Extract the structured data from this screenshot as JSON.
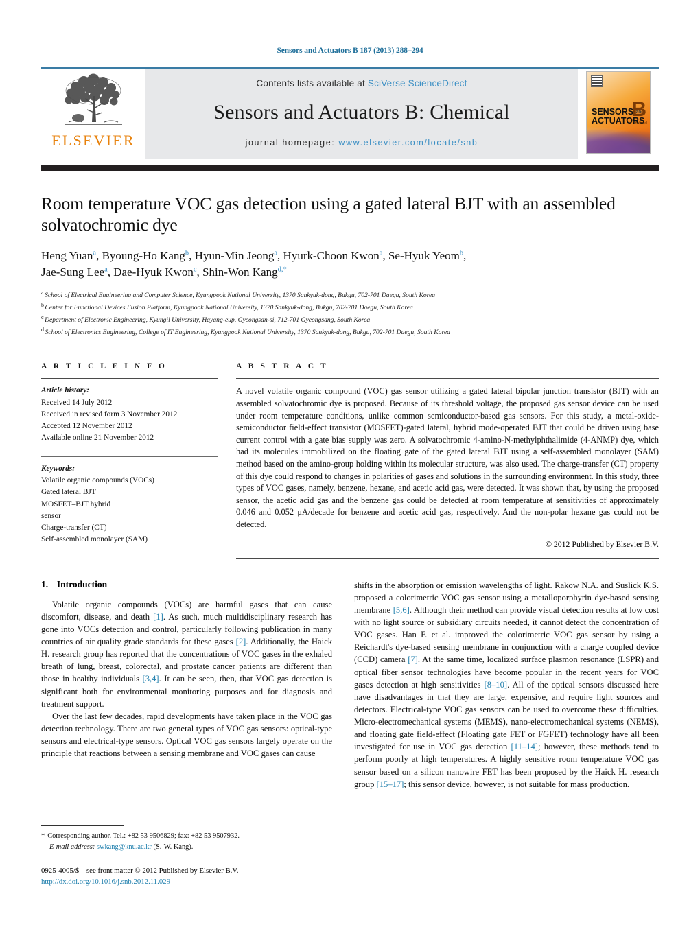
{
  "running_head": "Sensors and Actuators B 187 (2013) 288–294",
  "masthead": {
    "publisher_name": "ELSEVIER",
    "contents_prefix": "Contents lists available at ",
    "contents_link": "SciVerse ScienceDirect",
    "journal_title": "Sensors and Actuators B: Chemical",
    "homepage_prefix": "journal homepage: ",
    "homepage_url": "www.elsevier.com/locate/snb",
    "cover": {
      "line1": "SENSORS",
      "and": "and",
      "line2": "ACTUATORS",
      "letter": "B",
      "letter_sub": "Chemical"
    }
  },
  "article": {
    "title": "Room temperature VOC gas detection using a gated lateral BJT with an assembled solvatochromic dye",
    "authors": [
      {
        "name": "Heng Yuan",
        "marks": "a",
        "sep": ", "
      },
      {
        "name": "Byoung-Ho Kang",
        "marks": "b",
        "sep": ", "
      },
      {
        "name": "Hyun-Min Jeong",
        "marks": "a",
        "sep": ", "
      },
      {
        "name": "Hyurk-Choon Kwon",
        "marks": "a",
        "sep": ", "
      },
      {
        "name": "Se-Hyuk Yeom",
        "marks": "b",
        "sep": ","
      },
      {
        "name": "Jae-Sung Lee",
        "marks": "a",
        "sep": ", "
      },
      {
        "name": "Dae-Hyuk Kwon",
        "marks": "c",
        "sep": ", "
      },
      {
        "name": "Shin-Won Kang",
        "marks": "d,*",
        "sep": ""
      }
    ],
    "affiliations": [
      {
        "mark": "a",
        "text": "School of Electrical Engineering and Computer Science, Kyungpook National University, 1370 Sankyuk-dong, Bukgu, 702-701 Daegu, South Korea"
      },
      {
        "mark": "b",
        "text": "Center for Functional Devices Fusion Platform, Kyungpook National University, 1370 Sankyuk-dong, Bukgu, 702-701 Daegu, South Korea"
      },
      {
        "mark": "c",
        "text": "Department of Electronic Engineering, Kyungil University, Hayang-eup, Gyeongsan-si, 712-701 Gyeongsang, South Korea"
      },
      {
        "mark": "d",
        "text": "School of Electronics Engineering, College of IT Engineering, Kyungpook National University, 1370 Sankyuk-dong, Bukgu, 702-701 Daegu, South Korea"
      }
    ]
  },
  "article_info": {
    "heading": "A R T I C L E   I N F O",
    "history_label": "Article history:",
    "history": [
      "Received 14 July 2012",
      "Received in revised form 3 November 2012",
      "Accepted 12 November 2012",
      "Available online 21 November 2012"
    ],
    "keywords_label": "Keywords:",
    "keywords": [
      "Volatile organic compounds (VOCs)",
      "Gated lateral BJT",
      "MOSFET–BJT hybrid",
      "sensor",
      "Charge-transfer (CT)",
      "Self-assembled monolayer (SAM)"
    ]
  },
  "abstract": {
    "heading": "A B S T R A C T",
    "text": "A novel volatile organic compound (VOC) gas sensor utilizing a gated lateral bipolar junction transistor (BJT) with an assembled solvatochromic dye is proposed. Because of its threshold voltage, the proposed gas sensor device can be used under room temperature conditions, unlike common semiconductor-based gas sensors. For this study, a metal-oxide-semiconductor field-effect transistor (MOSFET)-gated lateral, hybrid mode-operated BJT that could be driven using base current control with a gate bias supply was zero. A solvatochromic 4-amino-N-methylphthalimide (4-ANMP) dye, which had its molecules immobilized on the floating gate of the gated lateral BJT using a self-assembled monolayer (SAM) method based on the amino-group holding within its molecular structure, was also used. The charge-transfer (CT) property of this dye could respond to changes in polarities of gases and solutions in the surrounding environment. In this study, three types of VOC gases, namely, benzene, hexane, and acetic acid gas, were detected. It was shown that, by using the proposed sensor, the acetic acid gas and the benzene gas could be detected at room temperature at sensitivities of approximately 0.046 and 0.052 μA/decade for benzene and acetic acid gas, respectively. And the non-polar hexane gas could not be detected.",
    "copyright": "© 2012 Published by Elsevier B.V."
  },
  "body": {
    "section_number": "1.",
    "section_title": "Introduction",
    "left_paragraphs": [
      "Volatile organic compounds (VOCs) are harmful gases that can cause discomfort, disease, and death [1]. As such, much multidisciplinary research has gone into VOCs detection and control, particularly following publication in many countries of air quality grade standards for these gases [2]. Additionally, the Haick H. research group has reported that the concentrations of VOC gases in the exhaled breath of lung, breast, colorectal, and prostate cancer patients are different than those in healthy individuals [3,4]. It can be seen, then, that VOC gas detection is significant both for environmental monitoring purposes and for diagnosis and treatment support.",
      "Over the last few decades, rapid developments have taken place in the VOC gas detection technology. There are two general types of VOC gas sensors: optical-type sensors and electrical-type sensors. Optical VOC gas sensors largely operate on the principle that reactions between a sensing membrane and VOC gases can cause"
    ],
    "right_paragraphs": [
      "shifts in the absorption or emission wavelengths of light. Rakow N.A. and Suslick K.S. proposed a colorimetric VOC gas sensor using a metalloporphyrin dye-based sensing membrane [5,6]. Although their method can provide visual detection results at low cost with no light source or subsidiary circuits needed, it cannot detect the concentration of VOC gases. Han F. et al. improved the colorimetric VOC gas sensor by using a Reichardt's dye-based sensing membrane in conjunction with a charge coupled device (CCD) camera [7]. At the same time, localized surface plasmon resonance (LSPR) and optical fiber sensor technologies have become popular in the recent years for VOC gases detection at high sensitivities [8–10]. All of the optical sensors discussed here have disadvantages in that they are large, expensive, and require light sources and detectors. Electrical-type VOC gas sensors can be used to overcome these difficulties. Micro-electromechanical systems (MEMS), nano-electromechanical systems (NEMS), and floating gate field-effect (Floating gate FET or FGFET) technology have all been investigated for use in VOC gas detection [11–14]; however, these methods tend to perform poorly at high temperatures. A highly sensitive room temperature VOC gas sensor based on a silicon nanowire FET has been proposed by the Haick H. research group [15–17]; this sensor device, however, is not suitable for mass production."
    ]
  },
  "footnote": {
    "marker": "*",
    "corresponding": "Corresponding author. Tel.: +82 53 9506829; fax: +82 53 9507932.",
    "email_label": "E-mail address:",
    "email": "swkang@knu.ac.kr",
    "email_suffix": "(S.-W. Kang)."
  },
  "issn_line": {
    "text": "0925-4005/$ – see front matter © 2012 Published by Elsevier B.V.",
    "doi": "http://dx.doi.org/10.1016/j.snb.2012.11.029"
  },
  "colors": {
    "link": "#3b8fc4",
    "reference": "#1f7fad",
    "running_head": "#1f6f9a",
    "elsevier_orange": "#E8820C",
    "masthead_band": "#e7e8ea",
    "black_bar": "#231f20"
  }
}
